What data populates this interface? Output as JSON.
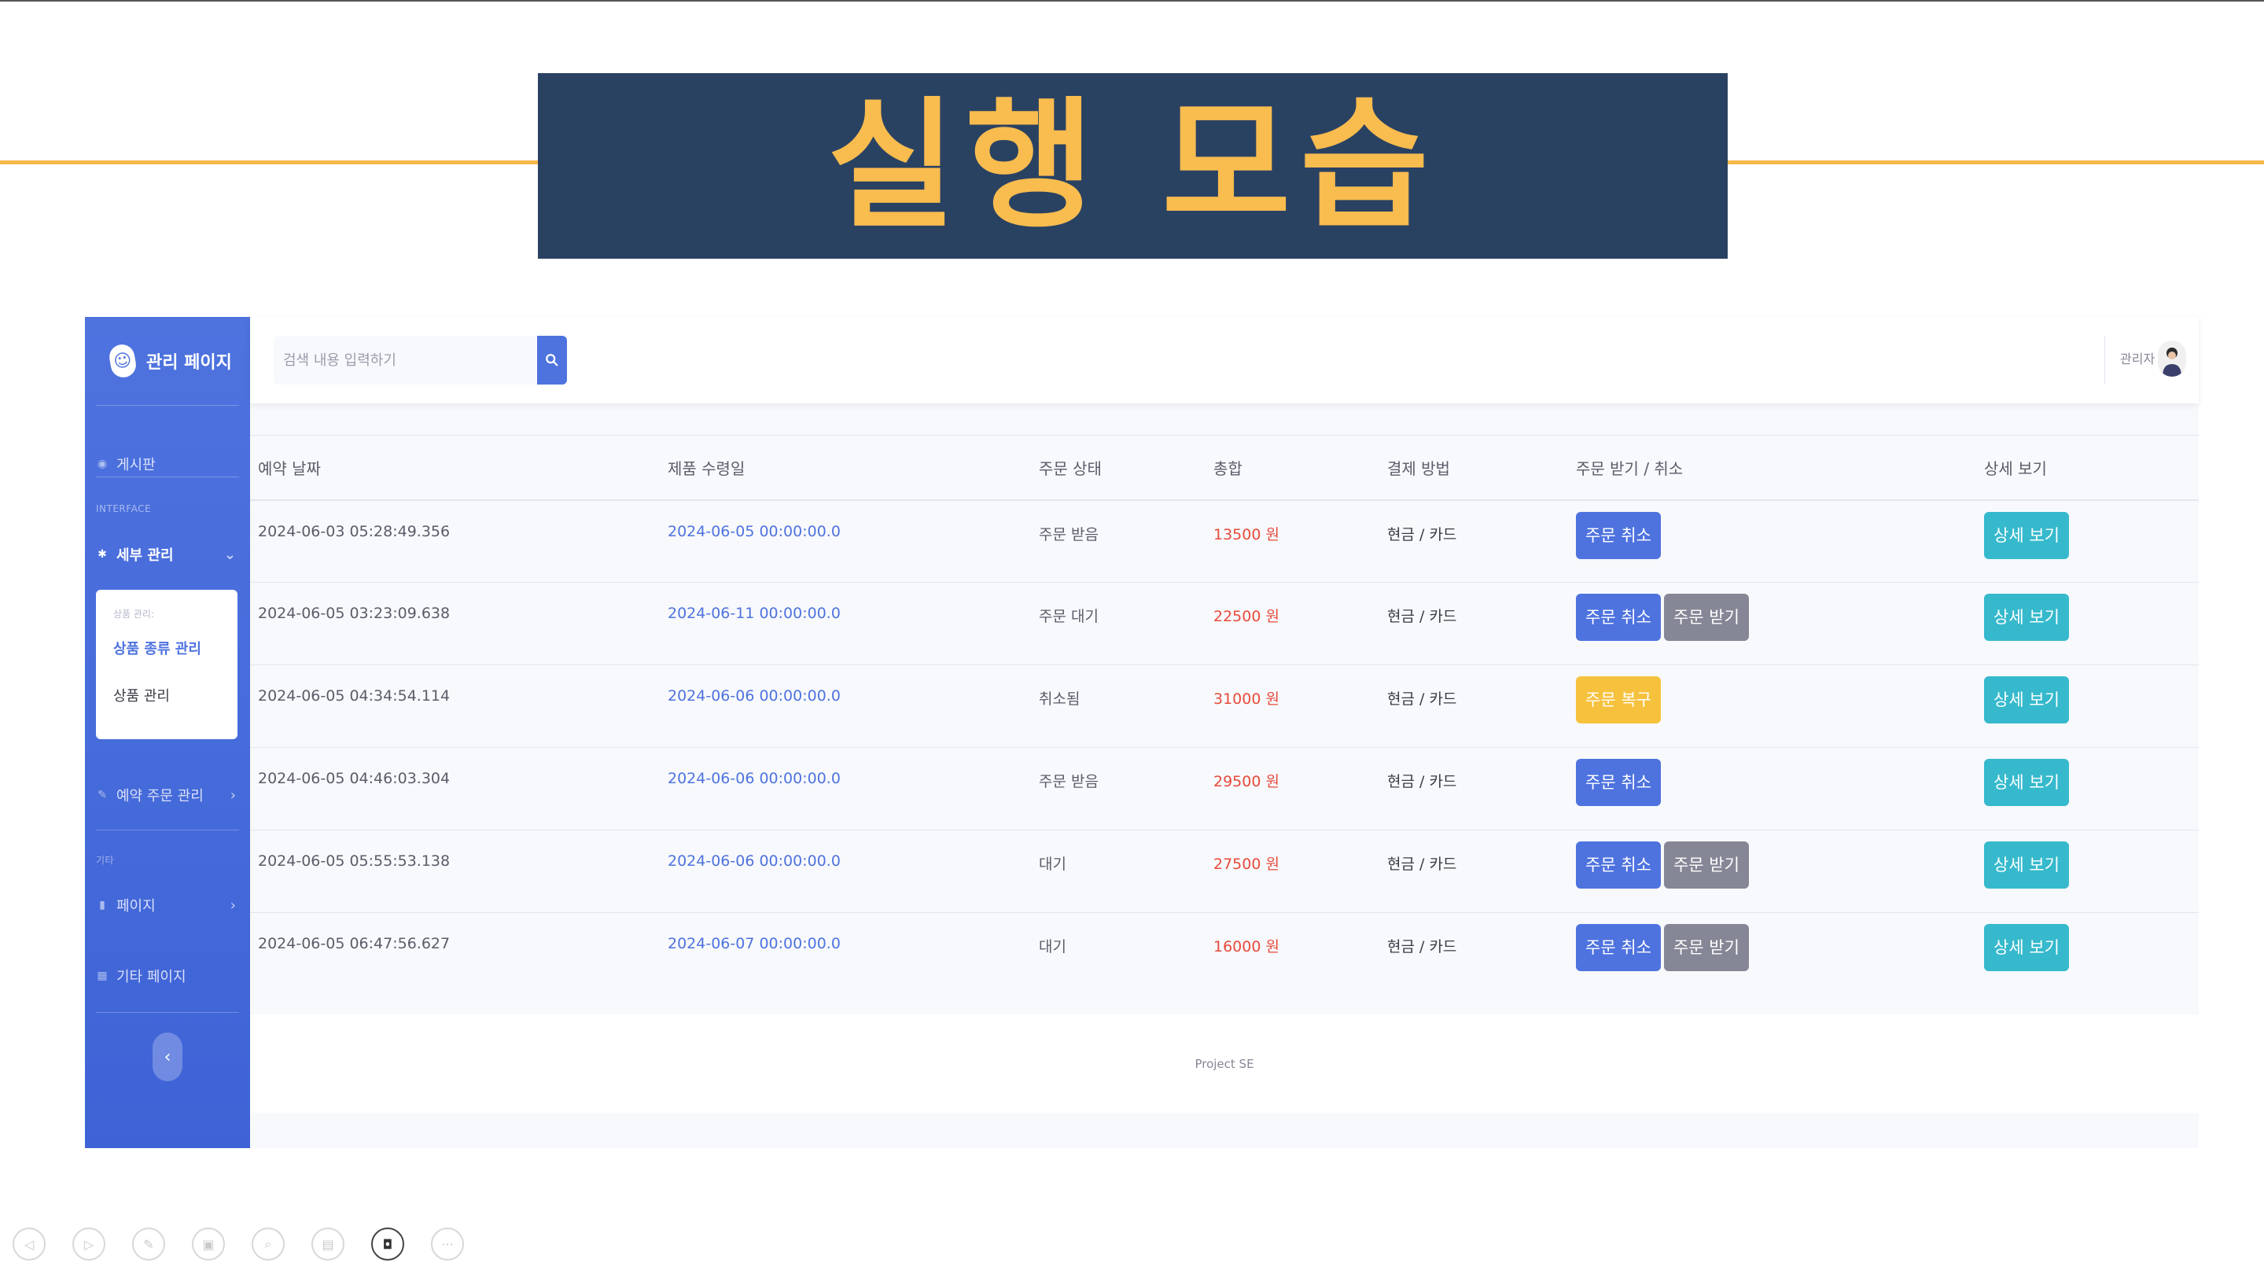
{
  "slide": {
    "title": "실행 모습"
  },
  "app": {
    "brand": {
      "name": "관리 페이지",
      "logo_text": "☺"
    },
    "sidebar": {
      "board": "게시판",
      "interface_heading": "INTERFACE",
      "detail_manage": "세부 관리",
      "submenu_heading": "상품 관리:",
      "submenu_items": [
        "상품 종류 관리",
        "상품 관리"
      ],
      "reservation_order": "예약 주문 관리",
      "etc_heading": "기타",
      "pages": "페이지",
      "other_pages": "기타 페이지"
    },
    "topbar": {
      "search_placeholder": "검색 내용 입력하기",
      "user_name": "관리자"
    },
    "table": {
      "headers": [
        "예약 날짜",
        "제품 수령일",
        "주문 상태",
        "총합",
        "결제 방법",
        "주문 받기 / 취소",
        "상세 보기"
      ],
      "rows": [
        {
          "reserved": "2024-06-03 05:28:49.356",
          "pickup": "2024-06-05 00:00:00.0",
          "status": "주문 받음",
          "total": "13500 원",
          "payment": "현금 / 카드",
          "actions": [
            "주문 취소"
          ],
          "detail": "상세 보기"
        },
        {
          "reserved": "2024-06-05 03:23:09.638",
          "pickup": "2024-06-11 00:00:00.0",
          "status": "주문 대기",
          "total": "22500 원",
          "payment": "현금 / 카드",
          "actions": [
            "주문 취소",
            "주문 받기"
          ],
          "detail": "상세 보기"
        },
        {
          "reserved": "2024-06-05 04:34:54.114",
          "pickup": "2024-06-06 00:00:00.0",
          "status": "취소됨",
          "total": "31000 원",
          "payment": "현금 / 카드",
          "actions": [
            "주문 복구"
          ],
          "detail": "상세 보기"
        },
        {
          "reserved": "2024-06-05 04:46:03.304",
          "pickup": "2024-06-06 00:00:00.0",
          "status": "주문 받음",
          "total": "29500 원",
          "payment": "현금 / 카드",
          "actions": [
            "주문 취소"
          ],
          "detail": "상세 보기"
        },
        {
          "reserved": "2024-06-05 05:55:53.138",
          "pickup": "2024-06-06 00:00:00.0",
          "status": "대기",
          "total": "27500 원",
          "payment": "현금 / 카드",
          "actions": [
            "주문 취소",
            "주문 받기"
          ],
          "detail": "상세 보기"
        },
        {
          "reserved": "2024-06-05 06:47:56.627",
          "pickup": "2024-06-07 00:00:00.0",
          "status": "대기",
          "total": "16000 원",
          "payment": "현금 / 카드",
          "actions": [
            "주문 취소",
            "주문 받기"
          ],
          "detail": "상세 보기"
        }
      ]
    },
    "footer": "Project SE"
  },
  "presentation_controls": [
    "previous-icon",
    "next-icon",
    "pen-icon",
    "slides-icon",
    "zoom-icon",
    "subtitles-icon",
    "camera-icon",
    "more-icon"
  ],
  "colors": {
    "banner_bg": "#2a4262",
    "banner_text": "#f9bc4f",
    "accent_line": "#f5b84a",
    "primary": "#4e73df",
    "secondary": "#858796",
    "warning": "#f6c23e",
    "info": "#36b9cc",
    "danger_text": "#e74a3b"
  }
}
